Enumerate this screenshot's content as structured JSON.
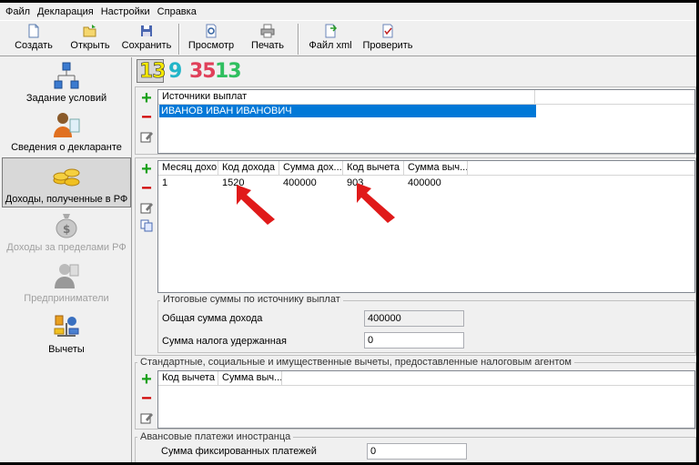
{
  "menu": [
    "Файл",
    "Декларация",
    "Настройки",
    "Справка"
  ],
  "toolbar": {
    "create": "Создать",
    "open": "Открыть",
    "save": "Сохранить",
    "preview": "Просмотр",
    "print": "Печать",
    "xml": "Файл xml",
    "check": "Проверить"
  },
  "nav": [
    {
      "label": "Задание условий",
      "state": "normal"
    },
    {
      "label": "Сведения о декларанте",
      "state": "normal"
    },
    {
      "label": "Доходы, полученные в РФ",
      "state": "active"
    },
    {
      "label": "Доходы за пределами РФ",
      "state": "disabled"
    },
    {
      "label": "Предприниматели",
      "state": "disabled"
    },
    {
      "label": "Вычеты",
      "state": "normal"
    }
  ],
  "rates": [
    "13",
    "9",
    "35",
    "13"
  ],
  "sources": {
    "header": "Источники выплат",
    "rows": [
      "ИВАНОВ ИВАН ИВАНОВИЧ"
    ]
  },
  "income": {
    "columns": [
      "Месяц дохо...",
      "Код дохода",
      "Сумма дох...",
      "Код вычета",
      "Сумма выч..."
    ],
    "rows": [
      [
        "1",
        "1520",
        "400000",
        "903",
        "400000"
      ]
    ]
  },
  "totals": {
    "title": "Итоговые суммы по источнику выплат",
    "income_label": "Общая сумма дохода",
    "income_value": "400000",
    "tax_label": "Сумма налога удержанная",
    "tax_value": "0"
  },
  "deductions": {
    "title": "Стандартные, социальные и имущественные вычеты, предоставленные налоговым агентом",
    "columns": [
      "Код вычета",
      "Сумма выч..."
    ]
  },
  "advance": {
    "title": "Авансовые платежи иностранца",
    "fixed_label": "Сумма фиксированных платежей",
    "fixed_value": "0"
  },
  "colors": {
    "selection": "#0078d7",
    "rate_yellow": "#f5e800",
    "rate_cyan": "#22b5c8",
    "rate_red": "#e0405a",
    "rate_green": "#2fbf5f",
    "arrow": "#e01a1a"
  }
}
